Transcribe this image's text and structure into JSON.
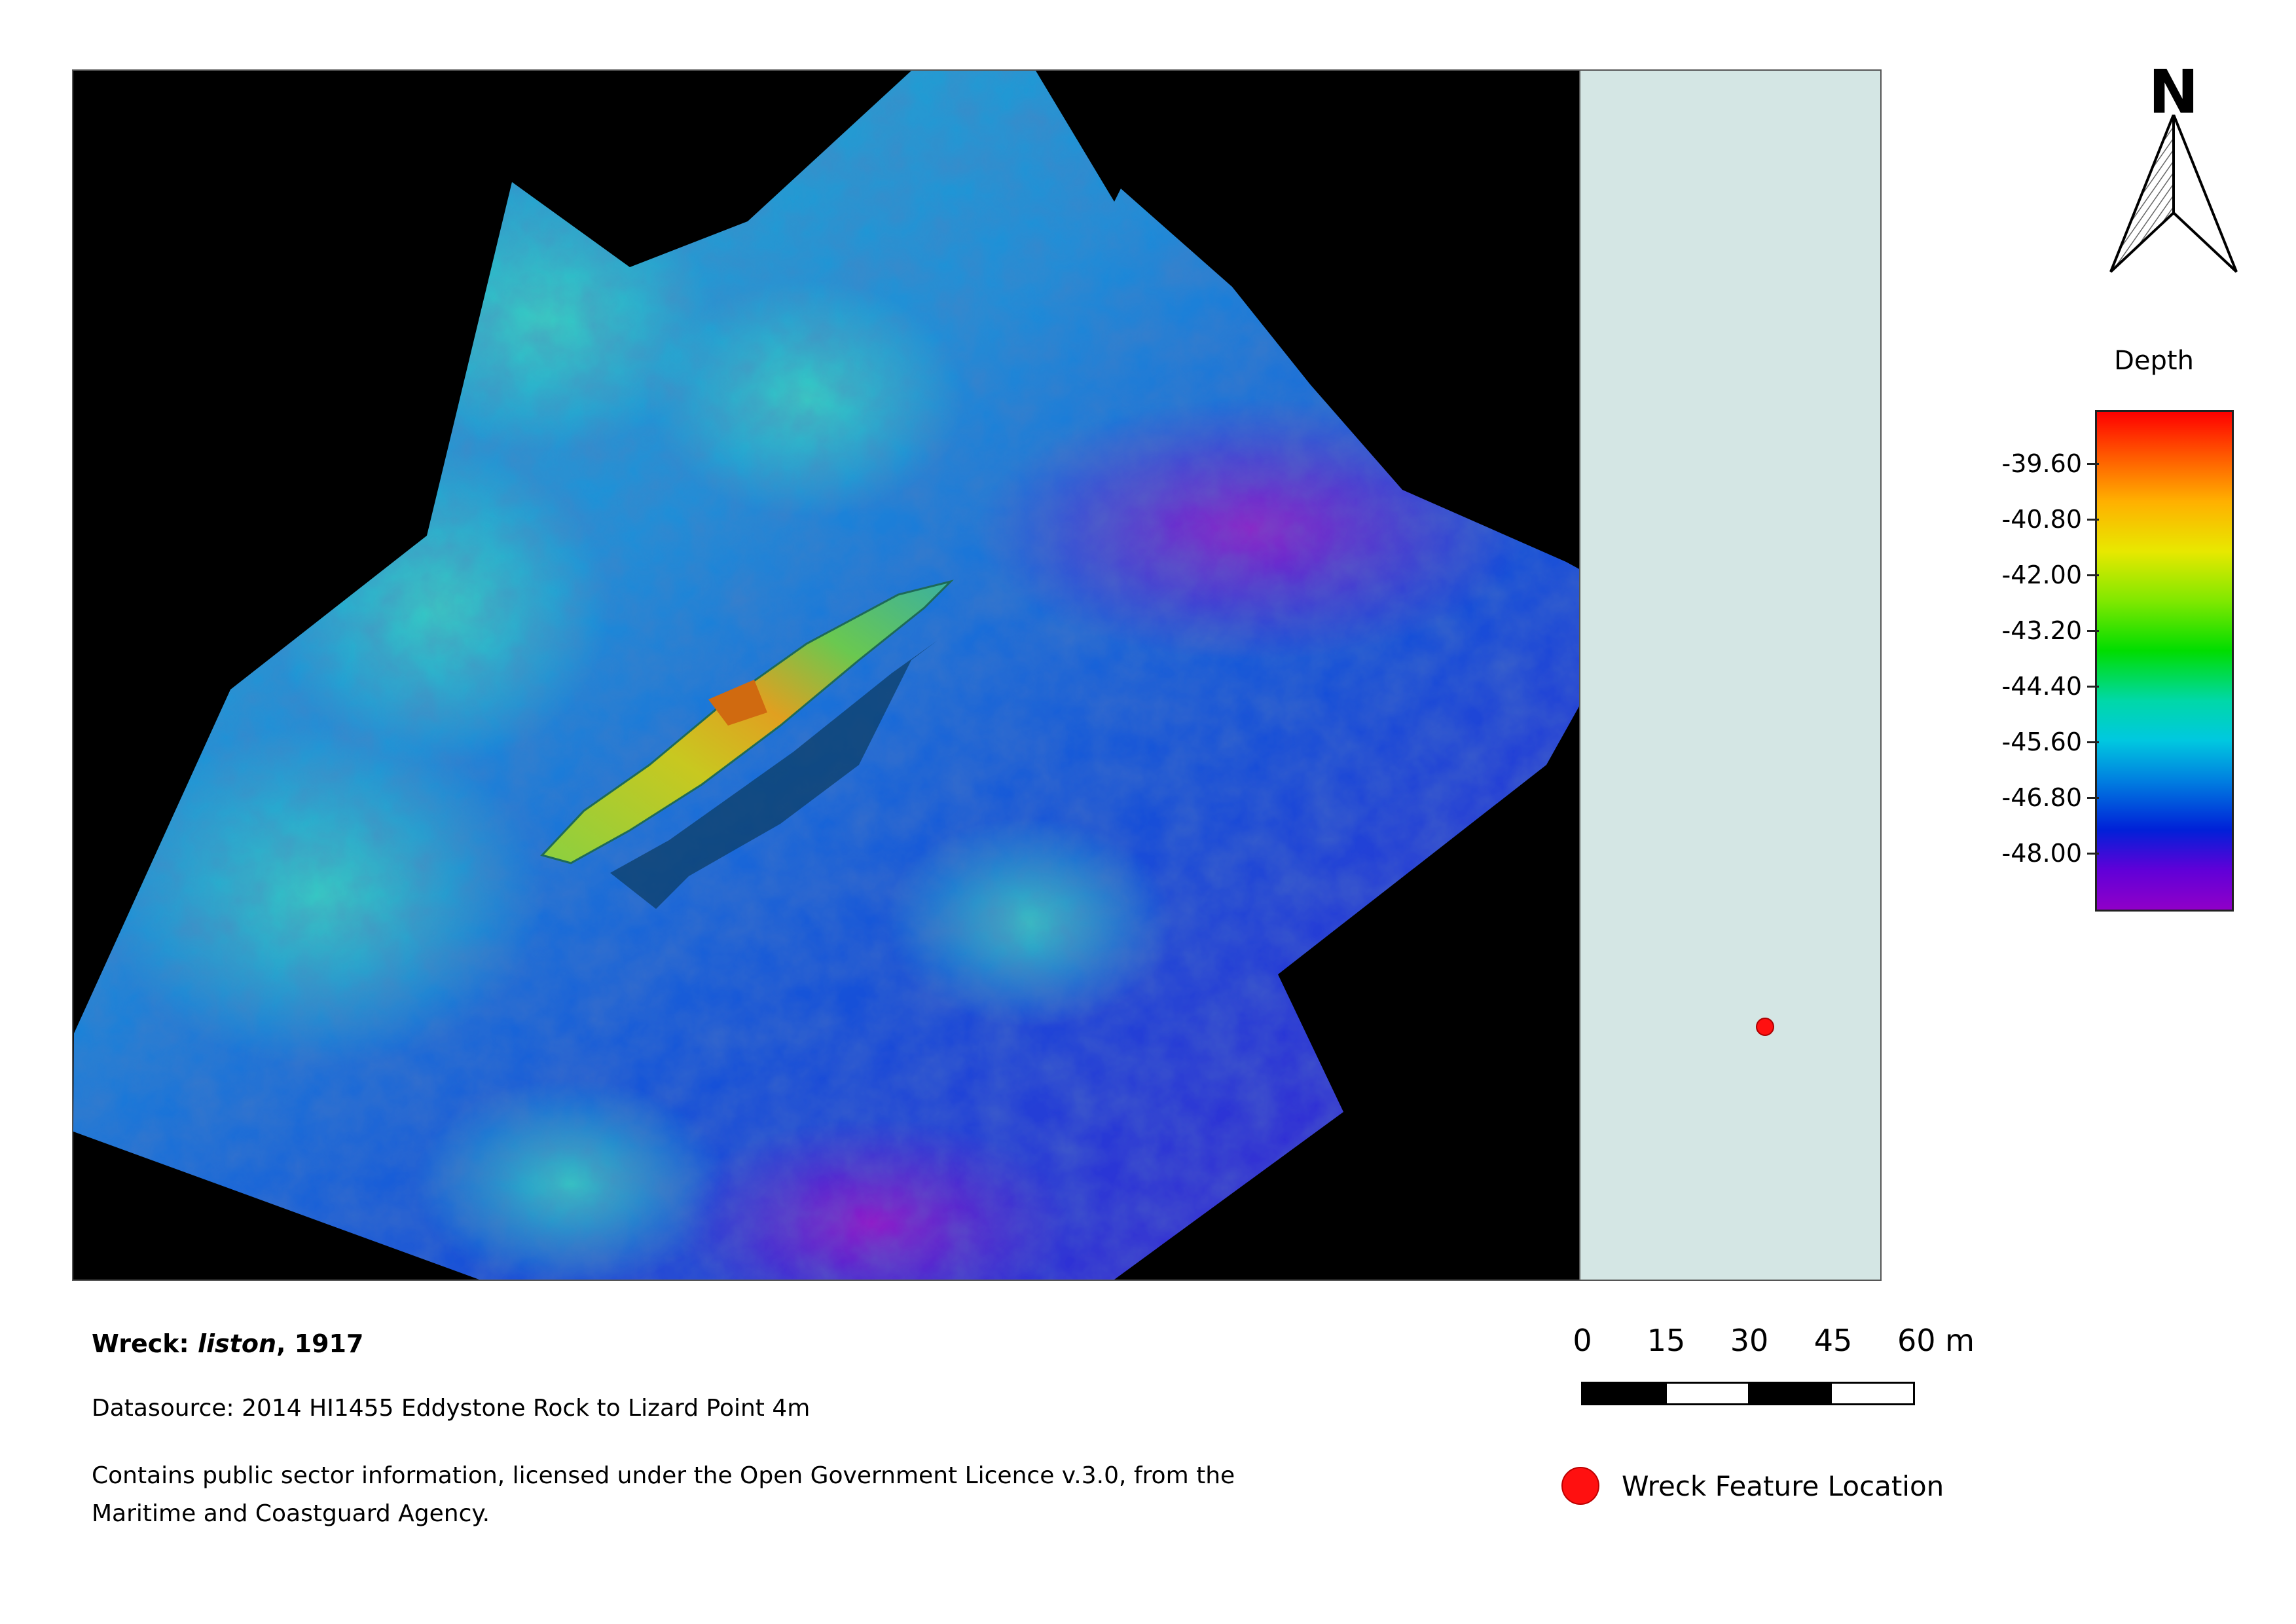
{
  "map": {
    "background_color": "#000000",
    "side_panel_color": "#d4e6e4",
    "wreck_point_color": "#ff1010"
  },
  "north_arrow": {
    "label": "N",
    "icon": "north-arrow-icon"
  },
  "legend": {
    "title": "Depth",
    "ticks": [
      "-39.60",
      "-40.80",
      "-42.00",
      "-43.20",
      "-44.40",
      "-45.60",
      "-46.80",
      "-48.00"
    ],
    "colors": [
      "#ff0000",
      "#ff8c00",
      "#e8e800",
      "#00dd00",
      "#00d8c8",
      "#0078e0",
      "#0020d8",
      "#9000c8"
    ]
  },
  "info": {
    "title_prefix": "Wreck:",
    "title_name": "liston",
    "title_suffix": ", 1917",
    "source": "Datasource: 2014 HI1455 Eddystone Rock to Lizard Point 4m",
    "licence": "Contains public sector information, licensed under the Open Government Licence v.3.0, from the Maritime and Coastguard Agency."
  },
  "scale_bar": {
    "labels": [
      "0",
      "15",
      "30",
      "45",
      "60 m"
    ]
  },
  "key": {
    "label": "Wreck Feature Location",
    "icon": "red-dot-icon"
  }
}
